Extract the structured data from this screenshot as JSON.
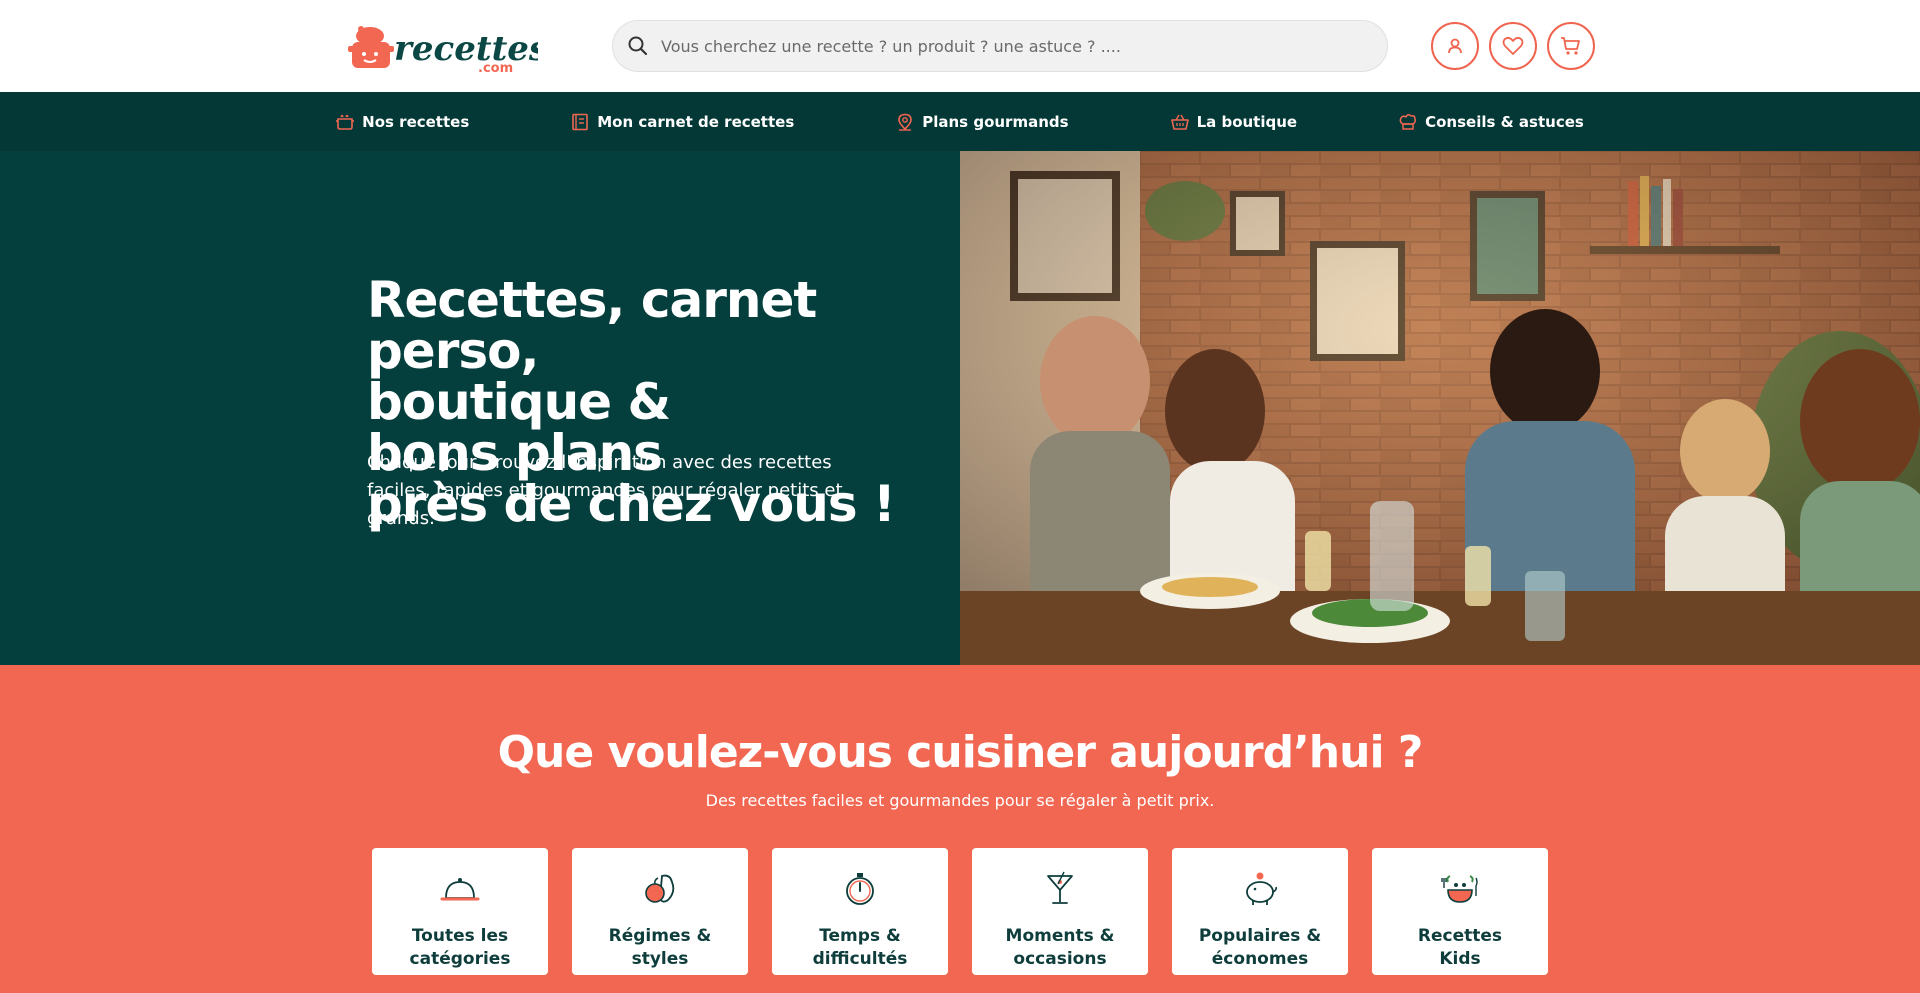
{
  "brand": {
    "logo_text": "recettes",
    "logo_sub": ".com"
  },
  "search": {
    "placeholder": "Vous cherchez une recette ? un produit ? une astuce ? ...."
  },
  "header_buttons": [
    "user-icon",
    "heart-icon",
    "cart-icon"
  ],
  "nav": {
    "items": [
      {
        "label": "Nos recettes",
        "icon": "pot-icon"
      },
      {
        "label": "Mon carnet de recettes",
        "icon": "notebook-icon"
      },
      {
        "label": "Plans gourmands",
        "icon": "location-pin-icon"
      },
      {
        "label": "La boutique",
        "icon": "basket-icon"
      },
      {
        "label": "Conseils & astuces",
        "icon": "chef-hat-icon"
      }
    ]
  },
  "hero": {
    "title_line1": "Recettes, carnet perso,",
    "title_line2_a": "boutique & ",
    "title_line2_b": "bons plans",
    "title_line3": "près de chez vous !",
    "subtitle": "Chaque jour, trouvez l'inspiration avec des recettes faciles, rapides et gourmandes pour régaler petits et grands.",
    "image_desc": "family-dinner-photo"
  },
  "categories": {
    "title": "Que voulez-vous cuisiner aujourd’hui ?",
    "subtitle": "Des recettes faciles et gourmandes pour se régaler à petit prix.",
    "items": [
      {
        "label": "Toutes les\ncatégories",
        "icon": "cloche-icon"
      },
      {
        "label": "Régimes &\nstyles",
        "icon": "vegetables-icon"
      },
      {
        "label": "Temps &\ndifficultés",
        "icon": "stopwatch-icon"
      },
      {
        "label": "Moments &\noccasions",
        "icon": "cocktail-icon"
      },
      {
        "label": "Populaires &\néconomes",
        "icon": "piggy-bank-icon"
      },
      {
        "label": "Recettes\nKids",
        "icon": "kids-plate-icon"
      }
    ]
  },
  "colors": {
    "primary": "#053f3d",
    "accent": "#f26752",
    "nav": "#043836"
  }
}
